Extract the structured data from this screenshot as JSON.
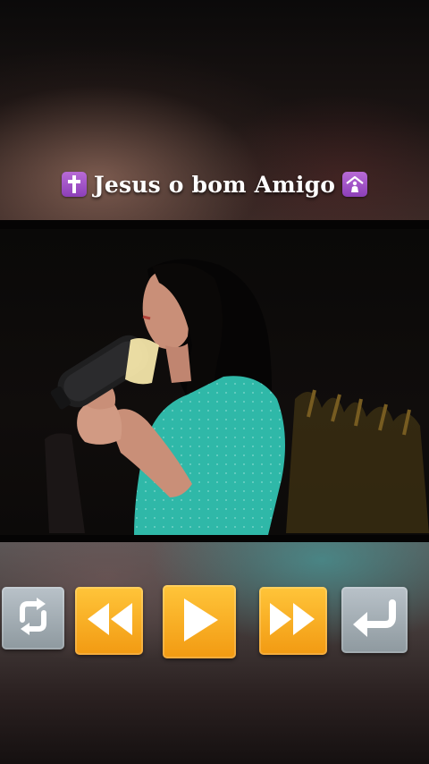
{
  "title": {
    "left_emoji": "latin-cross-icon",
    "text": "Jesus o bom Amigo",
    "right_emoji": "place-of-worship-icon"
  },
  "video": {
    "scene": "singer-with-microphone"
  },
  "controls": [
    {
      "name": "repeat-button",
      "icon": "repeat-icon",
      "color": "#a3adb4"
    },
    {
      "name": "previous-button",
      "icon": "rewind-icon",
      "color": "#f8b225"
    },
    {
      "name": "play-button",
      "icon": "play-icon",
      "color": "#f8b225"
    },
    {
      "name": "next-button",
      "icon": "fast-forward-icon",
      "color": "#f8b225"
    },
    {
      "name": "return-button",
      "icon": "return-arrow-icon",
      "color": "#a3adb4"
    }
  ],
  "colors": {
    "title_text": "#ffffff",
    "emoji_purple": "#a552c8",
    "shirt_teal": "#2fb8a8",
    "button_orange": "#f8b225",
    "button_gray": "#a3adb4"
  }
}
